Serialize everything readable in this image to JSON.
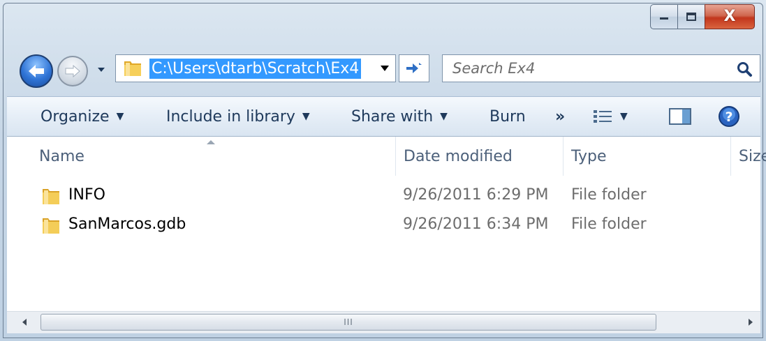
{
  "window": {
    "caption_close_glyph": "X"
  },
  "address_bar": {
    "path": "C:\\Users\\dtarb\\Scratch\\Ex4"
  },
  "search": {
    "placeholder": "Search Ex4"
  },
  "toolbar": {
    "organize": "Organize",
    "include_in_library": "Include in library",
    "share_with": "Share with",
    "burn": "Burn",
    "more": "»"
  },
  "columns": {
    "name": "Name",
    "date_modified": "Date modified",
    "type": "Type",
    "size": "Size"
  },
  "files": [
    {
      "name": "INFO",
      "date": "9/26/2011 6:29 PM",
      "type": "File folder"
    },
    {
      "name": "SanMarcos.gdb",
      "date": "9/26/2011 6:34 PM",
      "type": "File folder"
    }
  ],
  "scrollbar": {
    "grip": "III"
  },
  "colors": {
    "accent_selection": "#3399ff",
    "toolbar_text": "#1e395b",
    "close_button": "#c2361c",
    "folder": "#f0c24c"
  },
  "icons": {
    "back": "arrow-left-icon",
    "forward": "arrow-right-icon",
    "folder": "folder-icon",
    "refresh": "refresh-icon",
    "search": "search-icon",
    "help": "help-icon"
  }
}
